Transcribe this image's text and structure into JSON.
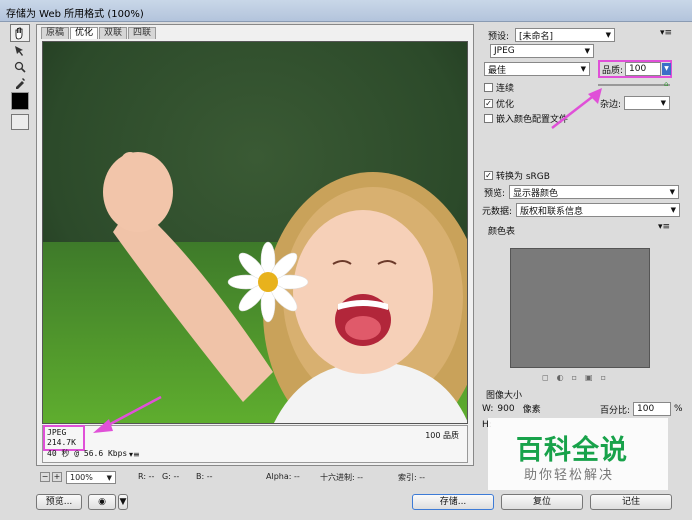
{
  "window": {
    "title": "存储为 Web 所用格式 (100%)"
  },
  "tabs": [
    "原稿",
    "优化",
    "双联",
    "四联"
  ],
  "active_tab": 1,
  "info": {
    "format": "JPEG",
    "size": "214.7K",
    "time": "40 秒 @ 56.6 Kbps",
    "quality": "100 品质"
  },
  "right": {
    "preset_label": "预设:",
    "preset_value": "[未命名]",
    "format": "JPEG",
    "compression": "最佳",
    "quality_label": "品质:",
    "quality_value": "100",
    "progressive": "连续",
    "optimized": "优化",
    "embed": "嵌入颜色配置文件",
    "blur_label": "杂边:",
    "convert": "转换为 sRGB",
    "preview_label": "预览:",
    "preview_value": "显示器颜色",
    "meta_label": "元数据:",
    "meta_value": "版权和联系信息",
    "colortable": "颜色表",
    "imagesize": "图像大小",
    "w_label": "W:",
    "w_value": "900",
    "px": "像素",
    "pct_label": "百分比:",
    "pct_value": "100",
    "pct": "%",
    "h_label": "H:"
  },
  "status": {
    "zoom": "100%",
    "r": "R: --",
    "g": "G: --",
    "b": "B: --",
    "alpha": "Alpha: --",
    "hex": "十六进制: --",
    "index": "索引: --"
  },
  "buttons": {
    "preview": "预览...",
    "save": "存储...",
    "reset": "复位",
    "remember": "记住"
  },
  "watermark": {
    "title": "百科全说",
    "subtitle": "助你轻松解决"
  },
  "colors": {
    "highlight": "#e050d8",
    "save_btn_border": "#3d7bd6"
  }
}
